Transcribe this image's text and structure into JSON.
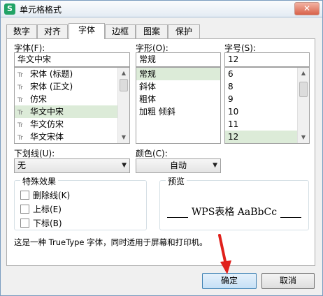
{
  "window": {
    "title": "单元格格式",
    "app_icon_letter": "S",
    "close_glyph": "✕"
  },
  "tabs": [
    {
      "label": "数字"
    },
    {
      "label": "对齐"
    },
    {
      "label": "字体",
      "active": true
    },
    {
      "label": "边框"
    },
    {
      "label": "图案"
    },
    {
      "label": "保护"
    }
  ],
  "font": {
    "label": "字体(F):",
    "value": "华文中宋",
    "tt_marker": "Tr",
    "items": [
      "宋体 (标题)",
      "宋体 (正文)",
      "仿宋",
      "华文中宋",
      "华文仿宋",
      "华文宋体"
    ],
    "selected": "华文中宋"
  },
  "style": {
    "label": "字形(O):",
    "value": "常规",
    "items": [
      "常规",
      "斜体",
      "粗体",
      "加粗 倾斜"
    ],
    "selected": "常规"
  },
  "size": {
    "label": "字号(S):",
    "value": "12",
    "items": [
      "6",
      "8",
      "9",
      "10",
      "11",
      "12"
    ],
    "selected": "12"
  },
  "underline": {
    "label": "下划线(U):",
    "value": "无"
  },
  "color": {
    "label": "颜色(C):",
    "value": "自动"
  },
  "effects": {
    "title": "特殊效果",
    "items": [
      "删除线(K)",
      "上标(E)",
      "下标(B)"
    ]
  },
  "preview": {
    "title": "预览",
    "text": "WPS表格  AaBbCc"
  },
  "info_text": "这是一种 TrueType 字体，同时适用于屏幕和打印机。",
  "buttons": {
    "ok": "确定",
    "cancel": "取消"
  },
  "colors": {
    "accent": "#21a366",
    "selection": "#dcebd8",
    "annotation_arrow": "#e0201b"
  }
}
